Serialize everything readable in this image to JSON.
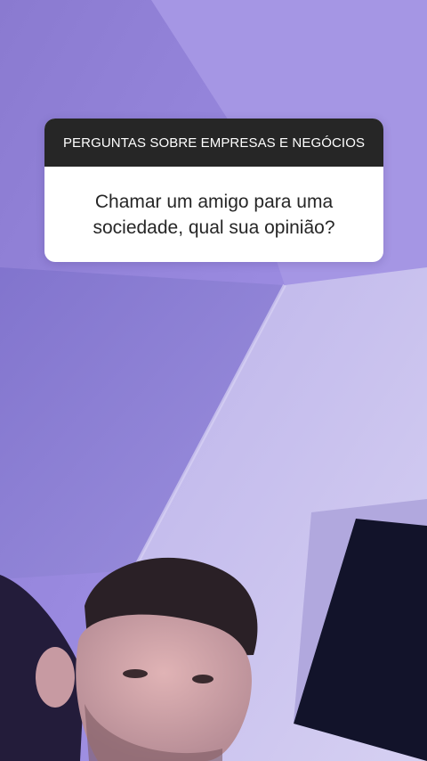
{
  "question_sticker": {
    "header": "PERGUNTAS SOBRE EMPRESAS E NEGÓCIOS",
    "question": "Chamar um amigo para uma\nsociedade, qual sua opinião?"
  },
  "colors": {
    "card_header_bg": "#262626",
    "card_body_bg": "#ffffff",
    "background_tint": "#8f80d6"
  }
}
